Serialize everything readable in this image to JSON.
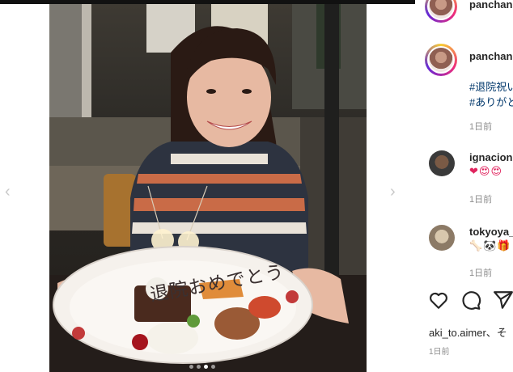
{
  "photo": {
    "plate_message": "退院おめでとう"
  },
  "carousel": {
    "prev_icon": "chevron-left-icon",
    "next_icon": "chevron-right-icon",
    "slides": 4,
    "active_index": 2
  },
  "header": {
    "username": "panchan"
  },
  "caption": {
    "username": "panchan",
    "hashtag_1": "#退院祝い",
    "hashtag_2": "#ありがと",
    "time": "1日前"
  },
  "comments": [
    {
      "username": "ignacion",
      "emojis": "❤😍😍",
      "time": "1日前",
      "reply": "「"
    },
    {
      "username": "tokyoya_",
      "emojis": "🦴🐼🎁",
      "time": "1日前"
    }
  ],
  "actions": {
    "like_icon": "heart-icon",
    "comment_icon": "comment-bubble-icon",
    "share_icon": "paper-plane-icon"
  },
  "likes": {
    "text": "aki_to.aimer、そ",
    "time": "1日前"
  },
  "colors": {
    "link": "#00376b",
    "muted": "#8e8e8e",
    "text": "#262626"
  }
}
